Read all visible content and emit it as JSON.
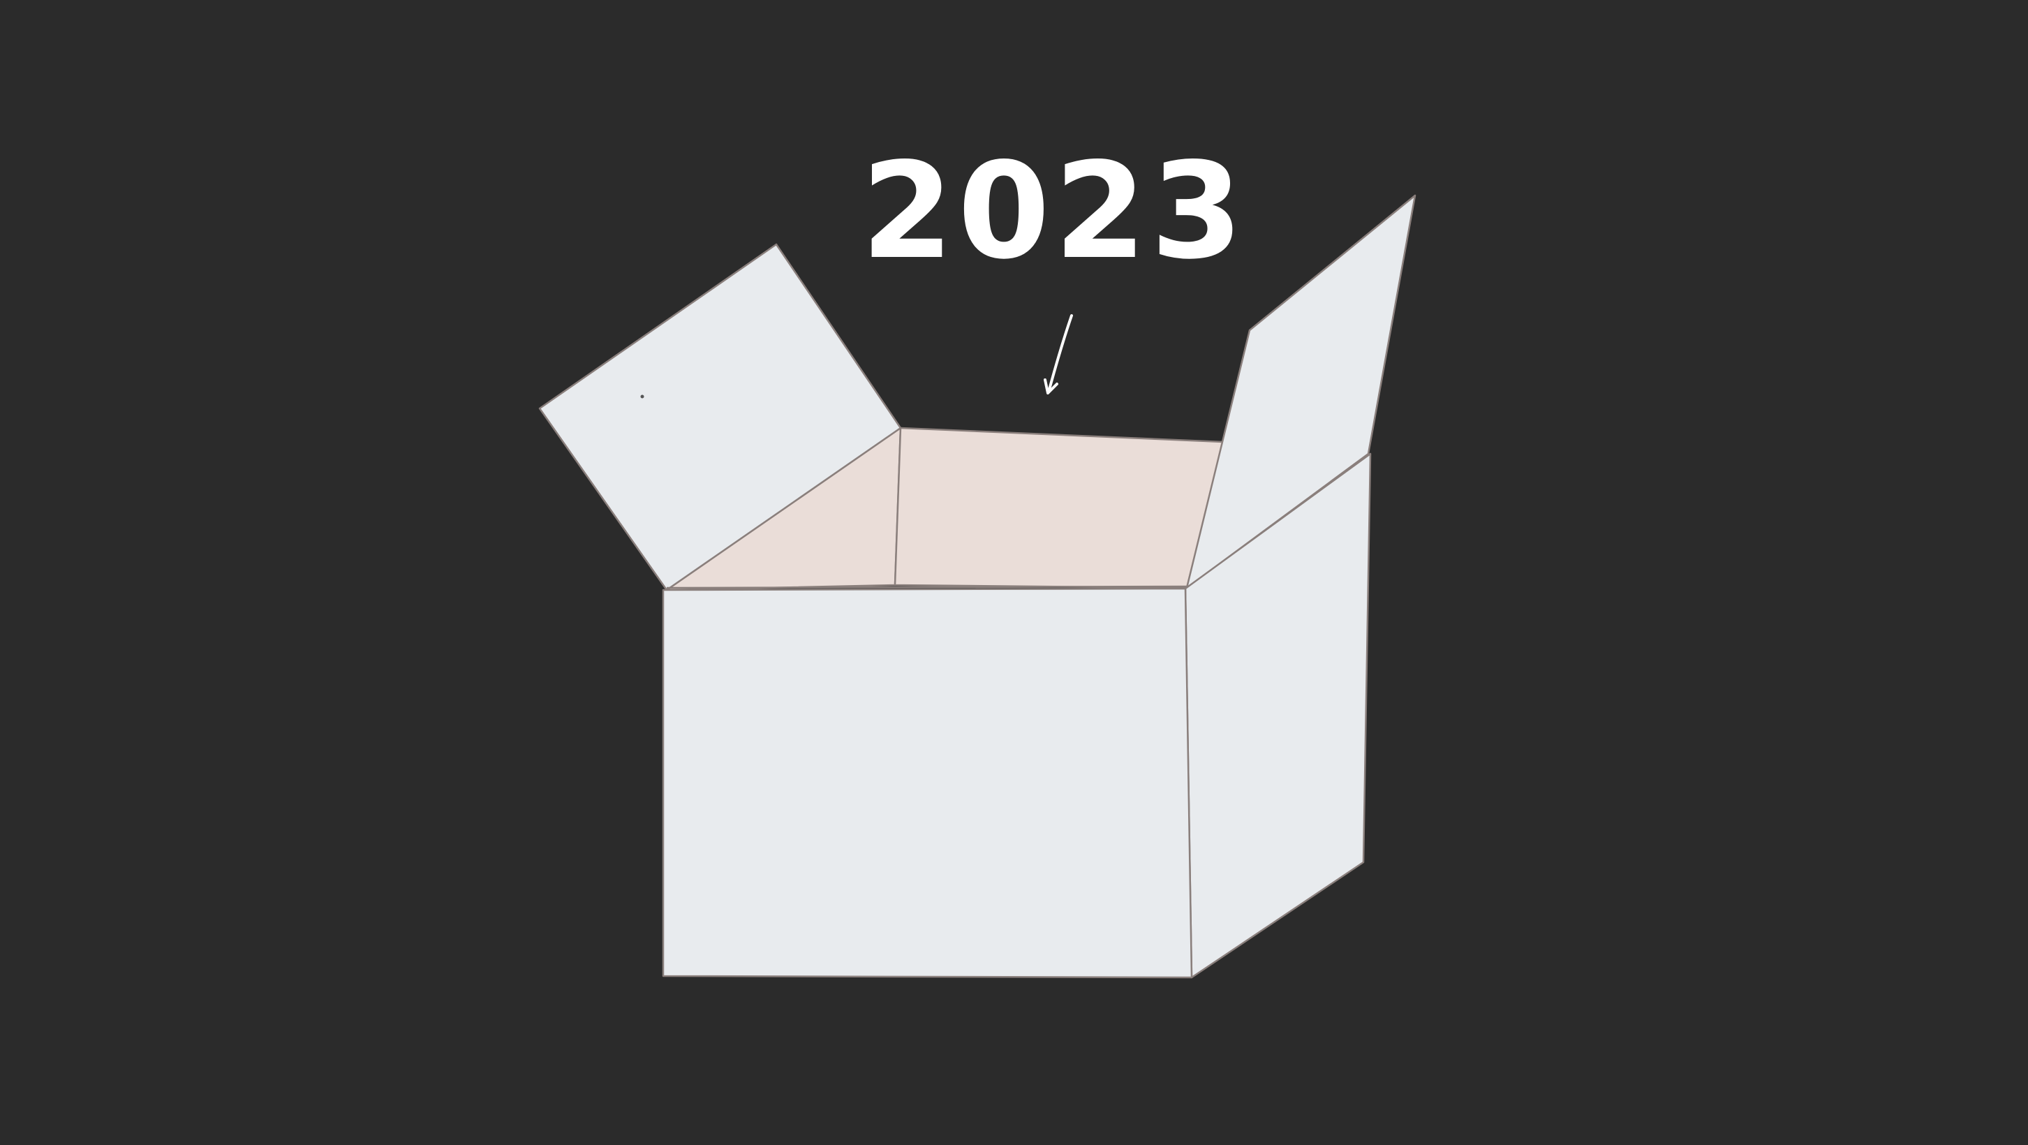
{
  "canvas": {
    "background_color": "#2b2b2b"
  },
  "annotation": {
    "text": "2023",
    "color": "#ffffff",
    "arrow_icon": "arrow-down-icon"
  },
  "box": {
    "front_color": "#e8ebee",
    "side_color": "#e8ebee",
    "flap_color": "#e8ebee",
    "interior_color": "#eaddd8",
    "outline_color": "#8a7f7c"
  }
}
